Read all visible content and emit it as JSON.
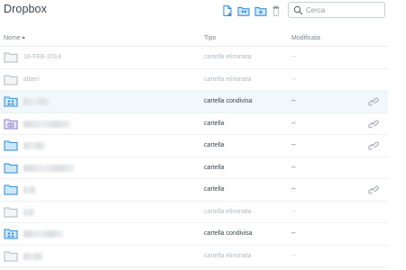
{
  "header": {
    "title": "Dropbox",
    "toolbar_icons": [
      "new-file-icon",
      "new-shared-folder-icon",
      "new-folder-icon",
      "show-deleted-icon"
    ],
    "search": {
      "value": "",
      "placeholder": "Cerca"
    }
  },
  "columns": {
    "name": "Nome",
    "type": "Tipo",
    "modified": "Modificata"
  },
  "colors": {
    "accent": "#2b8ad8",
    "folder_blue": "#cfe6f8",
    "deleted": "#b3b9bd",
    "text": "#3d464d"
  },
  "rows": [
    {
      "name": "16-FEB-2014",
      "type": "cartella eliminata",
      "modified": "--",
      "icon": "folder-deleted",
      "status": "deleted",
      "shared_link": false
    },
    {
      "name": "alberi",
      "type": "cartella eliminata",
      "modified": "--",
      "icon": "folder-deleted",
      "status": "deleted",
      "shared_link": false
    },
    {
      "name": "",
      "type": "cartella condivisa",
      "modified": "--",
      "icon": "folder-shared",
      "status": "active",
      "shared_link": true
    },
    {
      "name": "",
      "type": "cartella",
      "modified": "--",
      "icon": "folder-camera",
      "status": "active",
      "shared_link": true
    },
    {
      "name": "",
      "type": "cartella",
      "modified": "--",
      "icon": "folder",
      "status": "active",
      "shared_link": true
    },
    {
      "name": "",
      "type": "cartella",
      "modified": "--",
      "icon": "folder",
      "status": "active",
      "shared_link": false
    },
    {
      "name": "",
      "type": "cartella",
      "modified": "--",
      "icon": "folder",
      "status": "active",
      "shared_link": true
    },
    {
      "name": "",
      "type": "cartella eliminata",
      "modified": "--",
      "icon": "folder-deleted",
      "status": "deleted",
      "shared_link": false
    },
    {
      "name": "",
      "type": "cartella condivisa",
      "modified": "--",
      "icon": "folder-shared",
      "status": "active",
      "shared_link": false
    },
    {
      "name": "",
      "type": "cartella eliminata",
      "modified": "--",
      "icon": "folder-deleted",
      "status": "deleted",
      "shared_link": false
    }
  ]
}
